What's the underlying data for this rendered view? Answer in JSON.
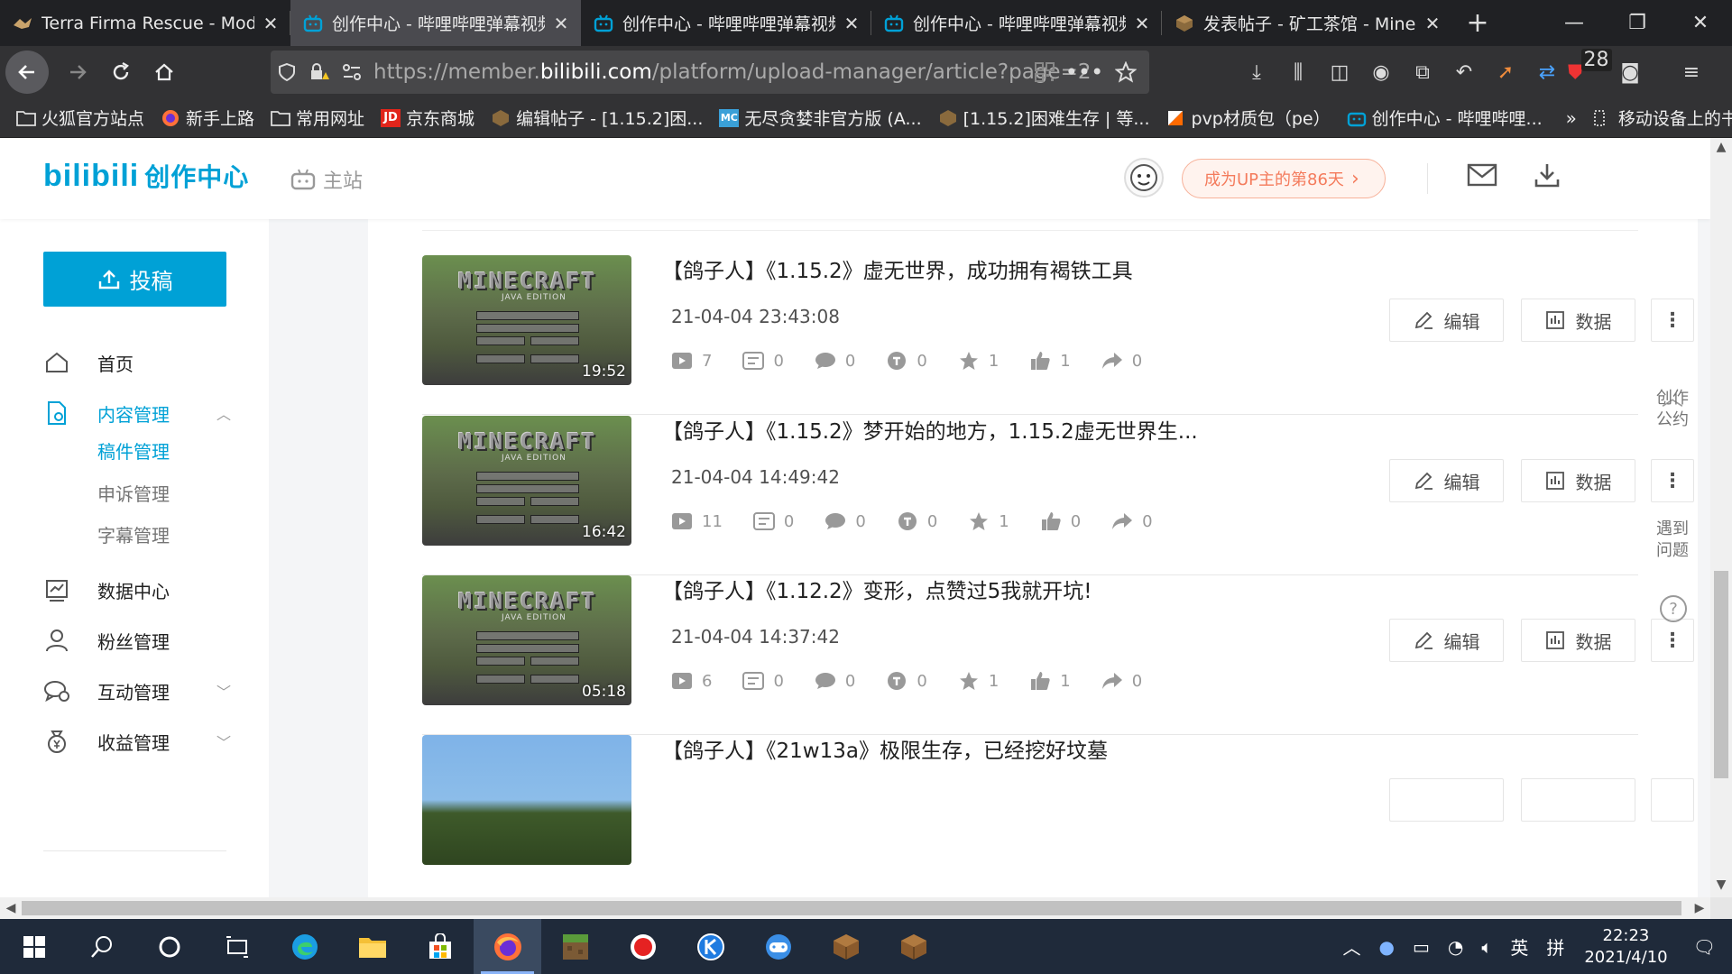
{
  "browser": {
    "tabs": [
      {
        "title": "Terra Firma Rescue - Modp",
        "favicon": "terra-firma-icon",
        "active": false
      },
      {
        "title": "创作中心 - 哔哩哔哩弹幕视频",
        "favicon": "bilibili-tv-icon",
        "active": true
      },
      {
        "title": "创作中心 - 哔哩哔哩弹幕视频",
        "favicon": "bilibili-tv-icon",
        "active": false
      },
      {
        "title": "创作中心 - 哔哩哔哩弹幕视频",
        "favicon": "bilibili-tv-icon",
        "active": false
      },
      {
        "title": "发表帖子 - 矿工茶馆 - Minec",
        "favicon": "mcbbs-icon",
        "active": false
      }
    ],
    "url_prefix": "https://member.",
    "url_domain": "bilibili.com",
    "url_path": "/platform/upload-manager/article?page=2",
    "extension_badge": "28",
    "bookmarks": [
      "火狐官方站点",
      "新手上路",
      "常用网址",
      "京东商城",
      "编辑帖子 - [1.15.2]困...",
      "无尽贪婪非官方版 (A...",
      "[1.15.2]困难生存 | 等...",
      "pvp材质包（pe）",
      "创作中心 - 哔哩哔哩...",
      "移动设备上的书签"
    ]
  },
  "header": {
    "logo_main": "bilibili",
    "logo_sub": "创作中心",
    "main_site": "主站",
    "up_days": "成为UP主的第86天"
  },
  "sidebar": {
    "post_button": "投稿",
    "items": [
      {
        "label": "首页"
      },
      {
        "label": "内容管理"
      },
      {
        "label": "数据中心"
      },
      {
        "label": "粉丝管理"
      },
      {
        "label": "互动管理"
      },
      {
        "label": "收益管理"
      }
    ],
    "subitems": [
      "稿件管理",
      "申诉管理",
      "字幕管理"
    ]
  },
  "videos": [
    {
      "title": "【鸽子人】《1.15.2》虚无世界，成功拥有褐铁工具",
      "time": "21-04-04 23:43:08",
      "duration": "19:52",
      "stats": {
        "play": "7",
        "danmaku": "0",
        "comment": "0",
        "coin": "0",
        "fav": "1",
        "like": "1",
        "share": "0"
      }
    },
    {
      "title": "【鸽子人】《1.15.2》梦开始的地方，1.15.2虚无世界生...",
      "time": "21-04-04 14:49:42",
      "duration": "16:42",
      "stats": {
        "play": "11",
        "danmaku": "0",
        "comment": "0",
        "coin": "0",
        "fav": "1",
        "like": "0",
        "share": "0"
      }
    },
    {
      "title": "【鸽子人】《1.12.2》变形，点赞过5我就开坑!",
      "time": "21-04-04 14:37:42",
      "duration": "05:18",
      "stats": {
        "play": "6",
        "danmaku": "0",
        "comment": "0",
        "coin": "0",
        "fav": "1",
        "like": "1",
        "share": "0"
      }
    },
    {
      "title": "【鸽子人】《21w13a》极限生存，已经挖好坟墓",
      "time": "",
      "duration": "",
      "stats": {}
    }
  ],
  "actions": {
    "edit": "编辑",
    "data": "数据"
  },
  "right_float": {
    "convention": "创作\n公约",
    "help": "遇到\n问题"
  },
  "taskbar": {
    "ime": "英",
    "ime2": "拼",
    "time": "22:23",
    "date": "2021/4/10"
  },
  "colors": {
    "accent": "#00a1d6",
    "pill_text": "#f47b5c"
  }
}
